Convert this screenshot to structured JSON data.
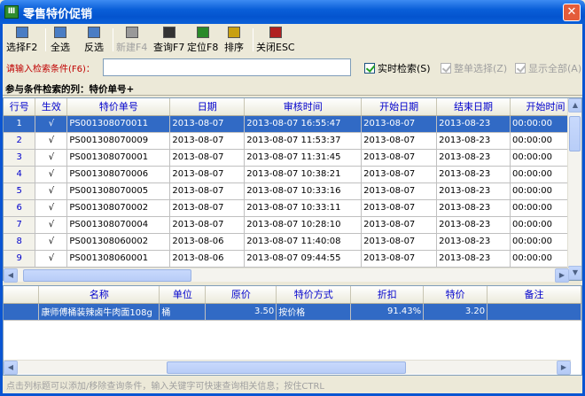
{
  "window": {
    "title": "零售特价促销",
    "app_icon": "Ⅲ",
    "close": "✕"
  },
  "toolbar": [
    {
      "name": "select-button",
      "label": "选择F2",
      "icon": "checklist-icon",
      "disabled": false
    },
    {
      "name": "select-all-button",
      "label": "全选",
      "icon": "select-all-icon",
      "disabled": false
    },
    {
      "name": "invert-selection-button",
      "label": "反选",
      "icon": "invert-icon",
      "disabled": false
    },
    {
      "name": "new-button",
      "label": "新建F4",
      "icon": "new-icon",
      "disabled": true
    },
    {
      "name": "query-button",
      "label": "查询F7",
      "icon": "binoculars-icon",
      "disabled": false
    },
    {
      "name": "locate-button",
      "label": "定位F8",
      "icon": "locate-icon",
      "disabled": false
    },
    {
      "name": "sort-button",
      "label": "排序",
      "icon": "sort-icon",
      "disabled": false
    },
    {
      "name": "close-esc-button",
      "label": "关闭ESC",
      "icon": "exit-icon",
      "disabled": false
    }
  ],
  "search": {
    "label": "请输入检索条件(F6)：",
    "value": ""
  },
  "options": {
    "realtime": "实时检索(S)",
    "whole": "整单选择(Z)",
    "showall": "显示全部(A)"
  },
  "cols_info": "参与条件检索的列：特价单号+",
  "master": {
    "columns": [
      "行号",
      "生效",
      "特价单号",
      "日期",
      "审核时间",
      "开始日期",
      "结束日期",
      "开始时间"
    ],
    "rows": [
      [
        "1",
        "√",
        "PS001308070011",
        "2013-08-07",
        "2013-08-07 16:55:47",
        "2013-08-07",
        "2013-08-23",
        "00:00:00"
      ],
      [
        "2",
        "√",
        "PS001308070009",
        "2013-08-07",
        "2013-08-07 11:53:37",
        "2013-08-07",
        "2013-08-23",
        "00:00:00"
      ],
      [
        "3",
        "√",
        "PS001308070001",
        "2013-08-07",
        "2013-08-07 11:31:45",
        "2013-08-07",
        "2013-08-23",
        "00:00:00"
      ],
      [
        "4",
        "√",
        "PS001308070006",
        "2013-08-07",
        "2013-08-07 10:38:21",
        "2013-08-07",
        "2013-08-23",
        "00:00:00"
      ],
      [
        "5",
        "√",
        "PS001308070005",
        "2013-08-07",
        "2013-08-07 10:33:16",
        "2013-08-07",
        "2013-08-23",
        "00:00:00"
      ],
      [
        "6",
        "√",
        "PS001308070002",
        "2013-08-07",
        "2013-08-07 10:33:11",
        "2013-08-07",
        "2013-08-23",
        "00:00:00"
      ],
      [
        "7",
        "√",
        "PS001308070004",
        "2013-08-07",
        "2013-08-07 10:28:10",
        "2013-08-07",
        "2013-08-23",
        "00:00:00"
      ],
      [
        "8",
        "√",
        "PS001308060002",
        "2013-08-06",
        "2013-08-07 11:40:08",
        "2013-08-07",
        "2013-08-23",
        "00:00:00"
      ],
      [
        "9",
        "√",
        "PS001308060001",
        "2013-08-06",
        "2013-08-07 09:44:55",
        "2013-08-07",
        "2013-08-23",
        "00:00:00"
      ]
    ]
  },
  "detail": {
    "columns": [
      "名称",
      "单位",
      "原价",
      "特价方式",
      "折扣",
      "特价",
      "备注"
    ],
    "rows": [
      [
        "康师傅桶装辣卤牛肉面108g",
        "桶",
        "3.50",
        "按价格",
        "91.43%",
        "3.20",
        ""
      ]
    ]
  },
  "status": "点击列标题可以添加/移除查询条件，输入关键字可快速查询相关信息；按住CTRL"
}
